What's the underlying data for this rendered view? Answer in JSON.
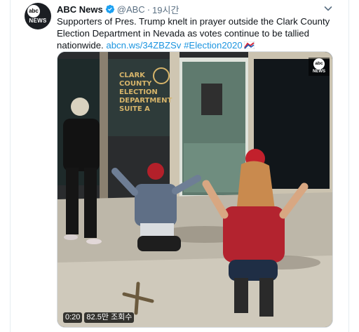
{
  "tweet": {
    "author_name": "ABC News",
    "handle": "@ABC",
    "separator": "·",
    "time": "19시간",
    "avatar": {
      "logo_text": "abc",
      "news_text": "NEWS"
    },
    "text_main": "Supporters of Pres. Trump knelt in prayer outside the Clark County Election Department in Nevada as votes continue to be tallied nationwide.",
    "link": "abcn.ws/34ZBZSv",
    "hashtag": "#Election2020"
  },
  "media": {
    "watermark": {
      "logo_text": "abc",
      "news_text": "NEWS"
    },
    "duration": "0:20",
    "views": "82.5만 조회수",
    "sign_text": [
      "CLARK",
      "COUNTY",
      "ELECTION",
      "DEPARTMENT",
      "SUITE A"
    ]
  },
  "colors": {
    "link": "#1b95e0",
    "verified": "#1da1f2",
    "meta_gray": "#5b7083"
  },
  "icons": [
    "verified-badge-icon",
    "caret-down-icon",
    "election-flag-icon"
  ]
}
